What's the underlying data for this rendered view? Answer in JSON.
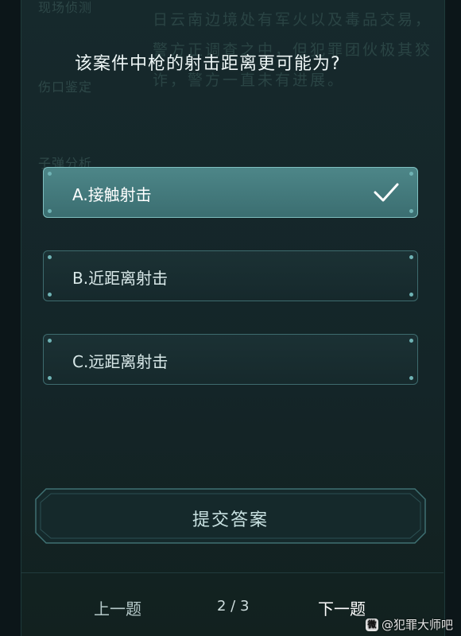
{
  "background_sidebar": {
    "items": [
      "现场侦测",
      "伤口鉴定",
      "子弹分析"
    ]
  },
  "background_story": "日云南边境处有军火以及毒品交易，警方正调查之中，但犯罪团伙极其狡诈，警方一直未有进展。",
  "question": "该案件中枪的射击距离更可能为?",
  "options": [
    {
      "label": "A.接触射击",
      "selected": true
    },
    {
      "label": "B.近距离射击",
      "selected": false
    },
    {
      "label": "C.远距离射击",
      "selected": false
    }
  ],
  "submit_label": "提交答案",
  "nav": {
    "prev_label": "上一题",
    "page_indicator": "2 / 3",
    "next_label": "下一题"
  },
  "watermark": {
    "icon": "weibo-icon",
    "text": "@犯罪大师吧"
  },
  "colors": {
    "panel": "#16292c",
    "accent": "#4d8688",
    "border": "#3e6b6e"
  }
}
